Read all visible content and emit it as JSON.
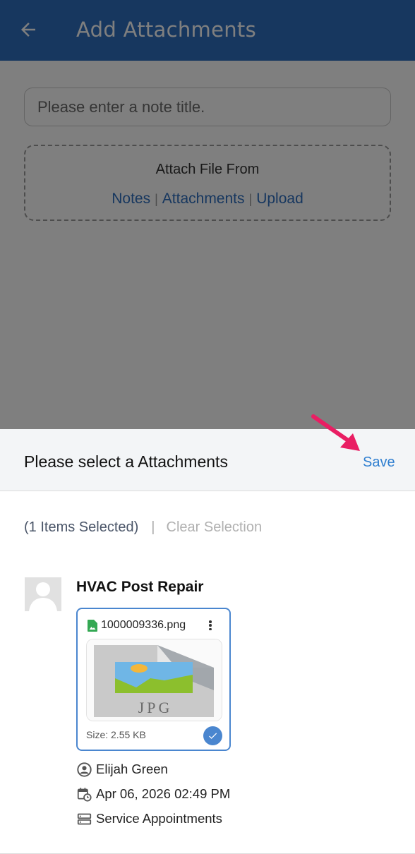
{
  "header": {
    "title": "Add Attachments"
  },
  "form": {
    "note_title_placeholder": "Please enter a note title.",
    "attach_heading": "Attach File From",
    "links": [
      {
        "label": "Notes"
      },
      {
        "label": "Attachments"
      },
      {
        "label": "Upload"
      }
    ]
  },
  "sheet": {
    "title": "Please select a Attachments",
    "save_label": "Save",
    "selected_count": "(1 Items Selected)",
    "separator": "|",
    "clear_label": "Clear Selection",
    "item": {
      "title": "HVAC Post Repair",
      "file_name": "1000009336.png",
      "thumbnail_label": "JPG",
      "size": "Size: 2.55 KB",
      "selected": true,
      "user": "Elijah Green",
      "date": "Apr 06, 2026 02:49 PM",
      "module": "Service Appointments"
    }
  },
  "colors": {
    "header_bg": "#2f6fbf",
    "accent": "#2f7fd0",
    "selection_border": "#4a86cf",
    "annotation_arrow": "#e91e63"
  },
  "icons": {
    "back": "arrow-left-icon",
    "file": "image-file-icon",
    "more": "more-vertical-icon",
    "check": "check-icon",
    "user": "user-circle-icon",
    "date": "calendar-clock-icon",
    "module": "server-icon"
  }
}
